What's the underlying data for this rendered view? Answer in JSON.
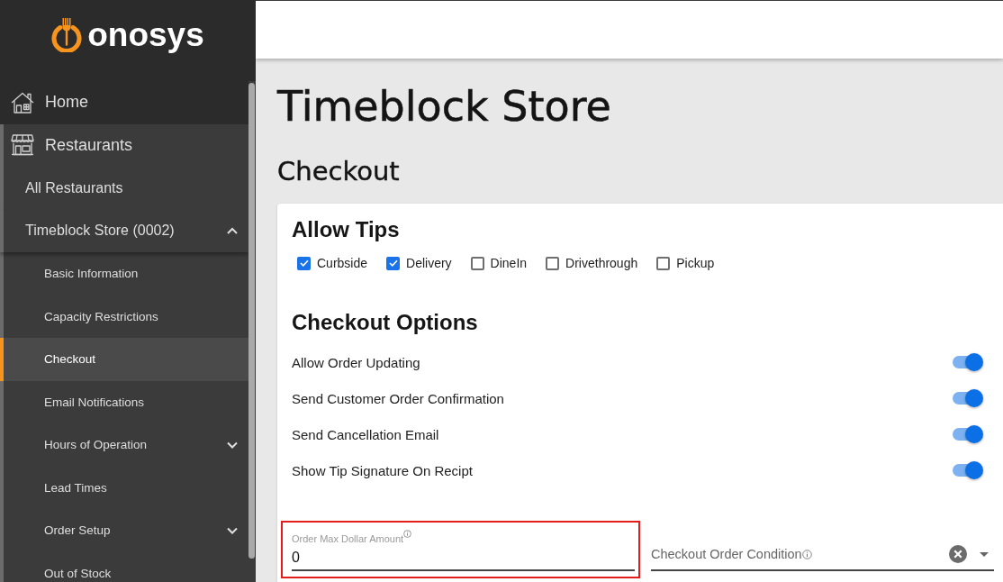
{
  "sidebar": {
    "logo": {
      "text": "onosys"
    },
    "items": [
      {
        "label": "Home",
        "selected": false
      },
      {
        "label": "Restaurants",
        "selected": false,
        "children": [
          {
            "label": "All Restaurants",
            "selected": false
          },
          {
            "label": "Timeblock Store (0002)",
            "selected": false,
            "expanded": true,
            "children": [
              {
                "label": "Basic Information",
                "selected": false
              },
              {
                "label": "Capacity Restrictions",
                "selected": false
              },
              {
                "label": "Checkout",
                "selected": true
              },
              {
                "label": "Email Notifications",
                "selected": false
              },
              {
                "label": "Hours of Operation",
                "selected": false,
                "expanded": false
              },
              {
                "label": "Lead Times",
                "selected": false
              },
              {
                "label": "Order Setup",
                "selected": false,
                "expanded": false
              },
              {
                "label": "Out of Stock",
                "selected": false
              }
            ]
          }
        ]
      }
    ]
  },
  "page": {
    "title": "Timeblock Store",
    "subtitle": "Checkout"
  },
  "card": {
    "tips": {
      "heading": "Allow Tips",
      "options": [
        {
          "label": "Curbside",
          "checked": true
        },
        {
          "label": "Delivery",
          "checked": true
        },
        {
          "label": "DineIn",
          "checked": false
        },
        {
          "label": "Drivethrough",
          "checked": false
        },
        {
          "label": "Pickup",
          "checked": false
        }
      ]
    },
    "options": {
      "heading": "Checkout Options",
      "toggles": [
        {
          "label": "Allow Order Updating",
          "on": true
        },
        {
          "label": "Send Customer Order Confirmation",
          "on": true
        },
        {
          "label": "Send Cancellation Email",
          "on": true
        },
        {
          "label": "Show Tip Signature On Recipt",
          "on": true
        }
      ]
    },
    "fields": [
      {
        "kind": "text",
        "label": "Order Max Dollar Amount",
        "value": "0",
        "highlighted": true
      },
      {
        "kind": "select",
        "label": "Checkout Order Condition"
      }
    ]
  }
}
